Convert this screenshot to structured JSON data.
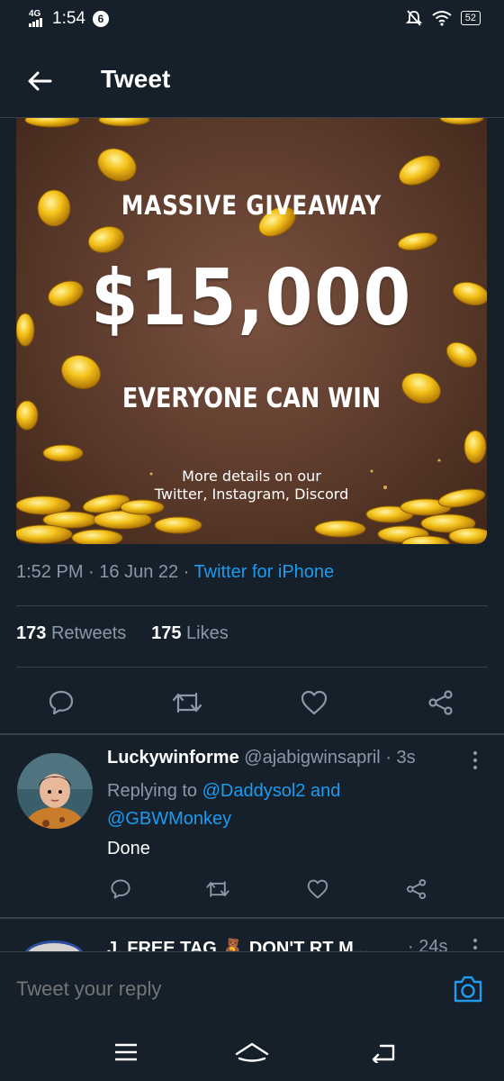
{
  "status_bar": {
    "network": "4G",
    "time": "1:54",
    "notification_count": "6",
    "battery": "52"
  },
  "header": {
    "title": "Tweet"
  },
  "image": {
    "line1": "MASSIVE GIVEAWAY",
    "line2": "$15,000",
    "line3": "EVERYONE CAN WIN",
    "line4a": "More details on our",
    "line4b": "Twitter, Instagram, Discord"
  },
  "tweet": {
    "time": "1:52 PM",
    "sep": " · ",
    "date": "16 Jun 22",
    "source": "Twitter for iPhone",
    "retweets_count": "173",
    "retweets_label": "Retweets",
    "likes_count": "175",
    "likes_label": "Likes"
  },
  "replies": [
    {
      "name": "Luckywinforme",
      "handle": "@ajabigwinsapril",
      "time": "· 3s",
      "replying_prefix": "Replying to",
      "replying_to_1": "@Daddysol2",
      "replying_and": "and",
      "replying_to_2": "@GBWMonkey",
      "text": "Done"
    },
    {
      "name": "J. FREE TAG 🧸 DON'T RT M...",
      "time": "· 24s"
    }
  ],
  "composer": {
    "placeholder": "Tweet your reply"
  },
  "icons": {
    "back": "arrow-left-icon",
    "reply": "comment-icon",
    "retweet": "retweet-icon",
    "like": "heart-icon",
    "share": "share-icon",
    "camera": "camera-icon"
  },
  "colors": {
    "background": "#15202b",
    "accent": "#1d9bf0",
    "muted": "#8b98a5",
    "divider": "#38444d"
  }
}
